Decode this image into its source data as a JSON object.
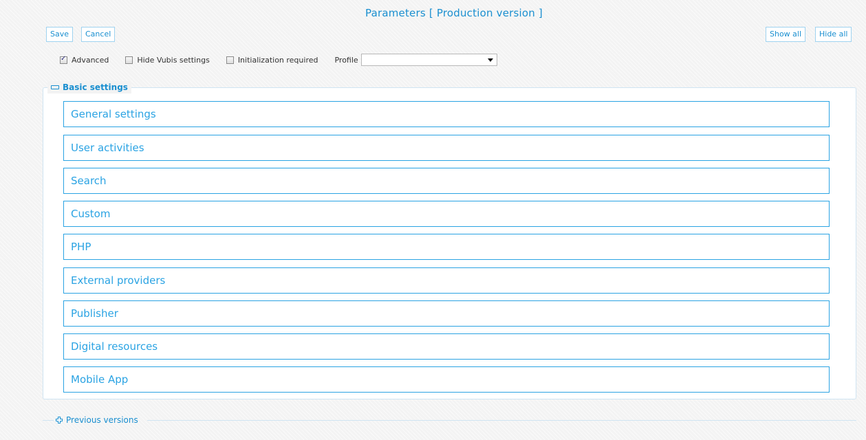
{
  "page": {
    "title": "Parameters [ Production version ]"
  },
  "toolbar": {
    "save_label": "Save",
    "cancel_label": "Cancel",
    "show_all_label": "Show all",
    "hide_all_label": "Hide all"
  },
  "options": {
    "advanced": {
      "label": "Advanced",
      "checked": true
    },
    "hide_vubis": {
      "label": "Hide Vubis settings",
      "checked": false
    },
    "init_required": {
      "label": "Initialization required",
      "checked": false
    },
    "profile": {
      "label": "Profile",
      "value": ""
    }
  },
  "basic_settings": {
    "legend": "Basic settings",
    "sections": [
      {
        "label": "General settings"
      },
      {
        "label": "User activities"
      },
      {
        "label": "Search"
      },
      {
        "label": "Custom"
      },
      {
        "label": "PHP"
      },
      {
        "label": "External providers"
      },
      {
        "label": "Publisher"
      },
      {
        "label": "Digital resources"
      },
      {
        "label": "Mobile App"
      }
    ]
  },
  "previous_versions": {
    "legend": "Previous versions"
  },
  "colors": {
    "accent": "#1a8fd0",
    "section_border": "#2aa3e3",
    "background": "#f3f3f3"
  },
  "icons": {
    "collapse": "minus-icon",
    "expand": "plus-icon",
    "dropdown": "chevron-down-icon",
    "checkbox": "checkbox-icon"
  }
}
